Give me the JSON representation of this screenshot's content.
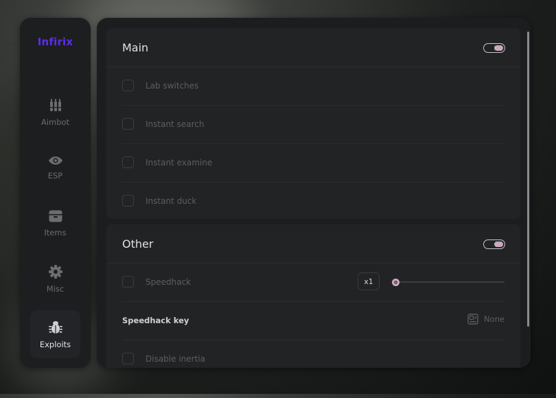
{
  "brand": "Infirix",
  "nav": [
    {
      "label": "Aimbot",
      "icon": "bullets-icon",
      "active": false
    },
    {
      "label": "ESP",
      "icon": "eye-icon",
      "active": false
    },
    {
      "label": "Items",
      "icon": "archive-box-icon",
      "active": false
    },
    {
      "label": "Misc",
      "icon": "gear-icon",
      "active": false
    },
    {
      "label": "Exploits",
      "icon": "bug-icon",
      "active": true
    }
  ],
  "main_section": {
    "title": "Main",
    "toggle_on": true,
    "items": [
      {
        "label": "Lab switches",
        "checked": false
      },
      {
        "label": "Instant search",
        "checked": false
      },
      {
        "label": "Instant examine",
        "checked": false
      },
      {
        "label": "Instant duck",
        "checked": false
      }
    ]
  },
  "other_section": {
    "title": "Other",
    "toggle_on": true,
    "speedhack": {
      "label": "Speedhack",
      "checked": false,
      "multiplier": "x1",
      "slider_fraction": 0.0
    },
    "speedhack_key": {
      "label": "Speedhack key",
      "value": "None",
      "icon": "keyboard-key-icon"
    },
    "disable_inertia": {
      "label": "Disable inertia",
      "checked": false
    }
  },
  "colors": {
    "accent": "#c9a9bd",
    "brand": "#5b2ee6",
    "panel": "#1c1d1f",
    "section": "#222325"
  }
}
